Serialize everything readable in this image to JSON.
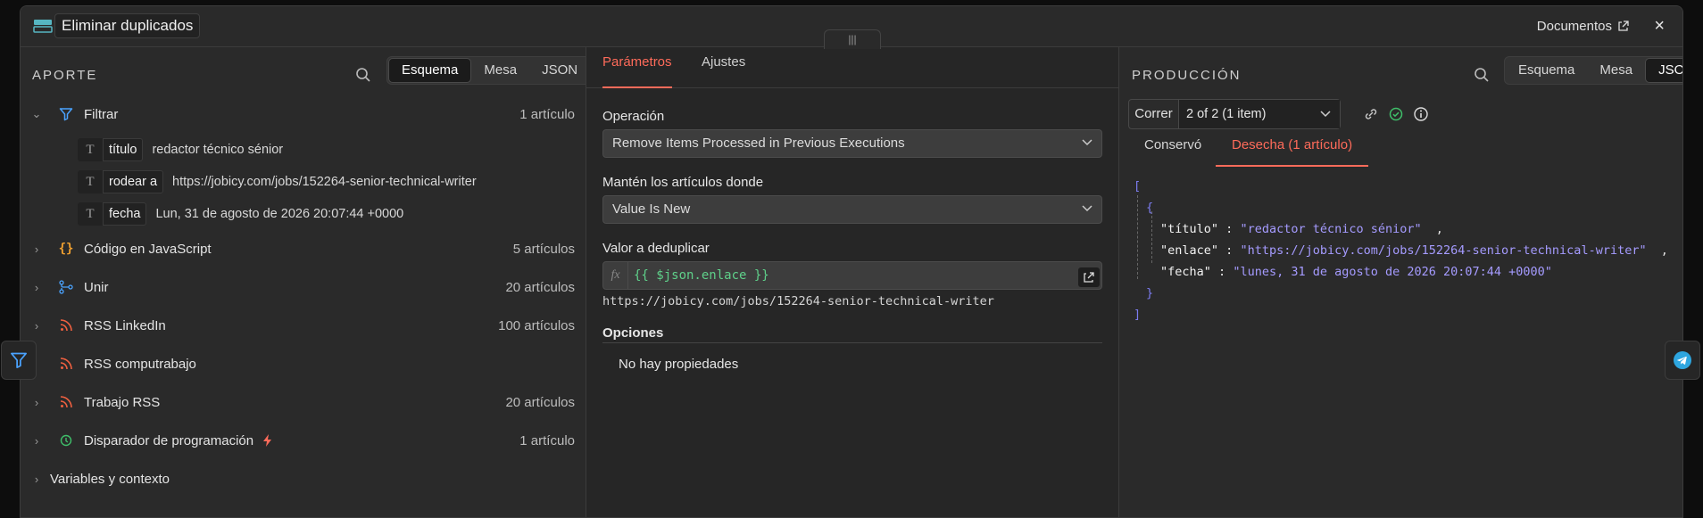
{
  "header": {
    "title": "Eliminar duplicados",
    "docs_label": "Documentos",
    "close_icon": "×",
    "drag_handle_glyph": "|||"
  },
  "input_panel": {
    "title": "APORTE",
    "views": [
      "Esquema",
      "Mesa",
      "JSON"
    ],
    "active_view": "Esquema",
    "tree": [
      {
        "label": "Filtrar",
        "count": "1 artículo",
        "icon": "filter-icon",
        "expanded": true
      },
      {
        "label": "Código en JavaScript",
        "count": "5 artículos",
        "icon": "code-braces-icon"
      },
      {
        "label": "Unir",
        "count": "20 artículos",
        "icon": "merge-icon"
      },
      {
        "label": "RSS LinkedIn",
        "count": "100 artículos",
        "icon": "rss-icon"
      },
      {
        "label": "RSS computrabajo",
        "count": "",
        "icon": "rss-icon"
      },
      {
        "label": "Trabajo RSS",
        "count": "20 artículos",
        "icon": "rss-icon"
      },
      {
        "label": "Disparador de programación",
        "count": "1 artículo",
        "icon": "clock-icon",
        "badge_icon": "lightning-icon"
      },
      {
        "label": "Variables y contexto",
        "count": ""
      }
    ],
    "fields": [
      {
        "name": "título",
        "value": "redactor técnico sénior"
      },
      {
        "name": "rodear a",
        "value": "https://jobicy.com/jobs/152264-senior-technical-writer"
      },
      {
        "name": "fecha",
        "value": "Lun, 31 de agosto de 2026 20:07:44 +0000"
      }
    ]
  },
  "params_panel": {
    "tabs": [
      "Parámetros",
      "Ajustes"
    ],
    "active_tab": "Parámetros",
    "operation_label": "Operación",
    "operation_value": "Remove Items Processed in Previous Executions",
    "keep_label": "Mantén los artículos donde",
    "keep_value": "Value Is New",
    "dedupe_label": "Valor a deduplicar",
    "dedupe_expr": "{{ $json.enlace }}",
    "dedupe_result": "https://jobicy.com/jobs/152264-senior-technical-writer",
    "options_label": "Opciones",
    "no_props": "No hay propiedades",
    "fx_label": "fx"
  },
  "output_panel": {
    "title": "PRODUCCIÓN",
    "views": [
      "Esquema",
      "Mesa",
      "JSON"
    ],
    "active_view": "JSON",
    "run_label": "Correr",
    "run_value": "2 of 2 (1 item)",
    "tabs": [
      "Conservó",
      "Desecha (1 artículo)"
    ],
    "active_tab": "Desecha (1 artículo)",
    "json": {
      "open_bracket": "[",
      "open_brace": "{",
      "close_brace": "}",
      "close_bracket": "]",
      "lines": [
        {
          "key": "\"título\"",
          "value": "\"redactor técnico sénior\"",
          "trail": ","
        },
        {
          "key": "\"enlace\"",
          "value": "\"https://jobicy.com/jobs/152264-senior-technical-writer\"",
          "trail": ","
        },
        {
          "key": "\"fecha\"",
          "value": "\"lunes, 31 de agosto de 2026 20:07:44 +0000\"",
          "trail": ""
        }
      ]
    }
  },
  "colors": {
    "accent": "#ff6b5a",
    "success": "#3fbf6a",
    "json_string": "#a59bff",
    "expr_green": "#5fd08a"
  }
}
